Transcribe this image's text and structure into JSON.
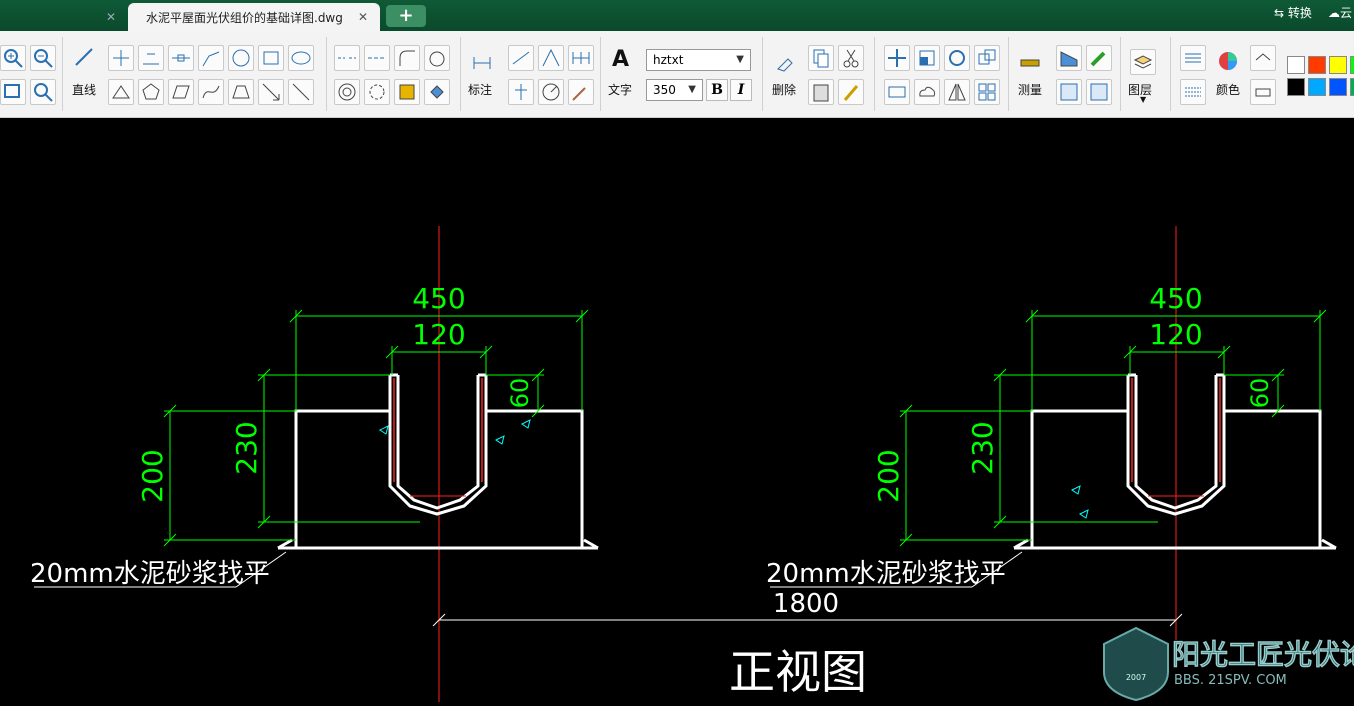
{
  "titlebar": {
    "tabs": [
      {
        "label": "",
        "close": "✕"
      },
      {
        "label": "水泥平屋面光伏组价的基础详图.dwg",
        "close": "✕"
      }
    ],
    "new_tab": "+",
    "right": {
      "convert": "转换",
      "cloud": "云"
    }
  },
  "toolbar": {
    "line_label": "直线",
    "dim_label": "标注",
    "text_label": "文字",
    "text_icon": "A",
    "font_name": "hztxt",
    "font_size": "350",
    "bold": "B",
    "italic": "I",
    "delete_label": "删除",
    "measure_label": "测量",
    "layer_label": "图层",
    "color_label": "颜色",
    "palette": [
      "#ffffff",
      "#ff3b00",
      "#ffff00",
      "#00ff00",
      "#000000",
      "#00a8ff",
      "#0055ff",
      "#00b050"
    ]
  },
  "drawing": {
    "left": {
      "width": "450",
      "gap": "120",
      "edge": "60",
      "depth": "230",
      "height": "200",
      "note": "20mm水泥砂浆找平"
    },
    "right": {
      "width": "450",
      "gap": "120",
      "edge": "60",
      "depth": "230",
      "height": "200",
      "note": "20mm水泥砂浆找平"
    },
    "spacing": "1800",
    "view_title": "正视图"
  },
  "watermark": {
    "text": "阳光工匠光伏论坛",
    "url": "BBS. 21SPV. COM",
    "year": "2007"
  },
  "colors": {
    "dimension": "#00ff00",
    "outline": "#ffffff",
    "centerline": "#ff0000",
    "background": "#000000"
  }
}
